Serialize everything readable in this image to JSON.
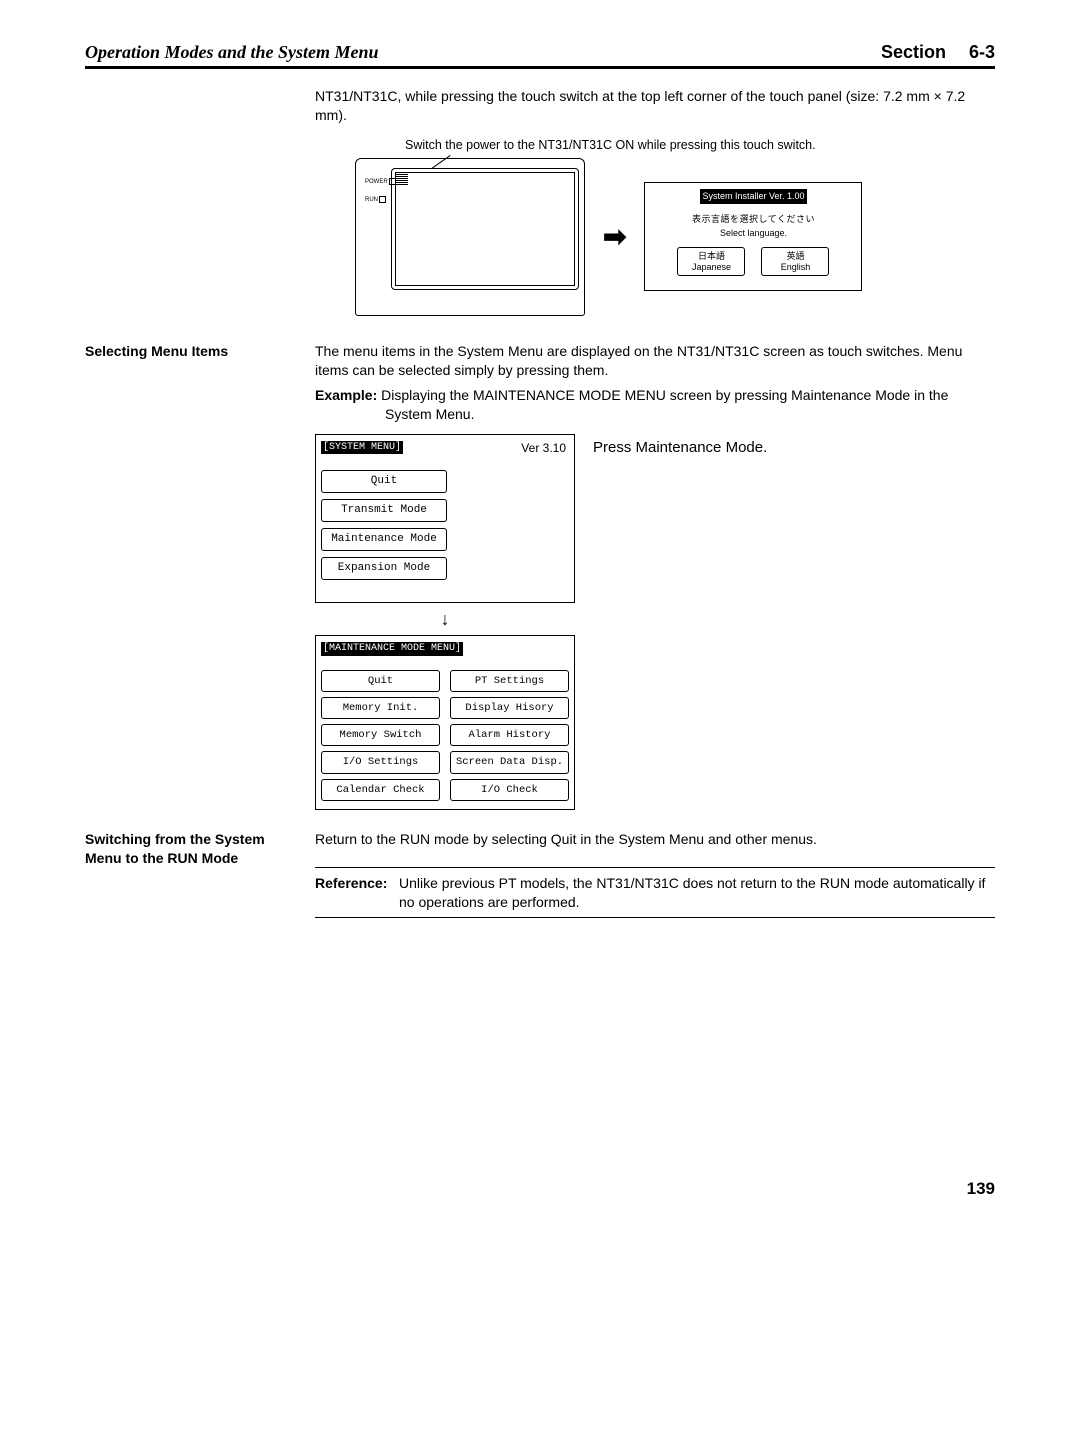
{
  "header": {
    "left": "Operation Modes and the System Menu",
    "section_word": "Section",
    "section_num": "6-3"
  },
  "intro": {
    "para": "NT31/NT31C, while pressing the touch switch at the top left corner of the touch panel (size: 7.2 mm × 7.2 mm).",
    "caption": "Switch the power to the NT31/NT31C ON while pressing this touch switch."
  },
  "touchpanel": {
    "led1": "POWER",
    "led2": "RUN"
  },
  "arrow_right": "➡",
  "lang_panel": {
    "title": "System Installer  Ver. 1.00",
    "line_jp": "表示言語を選択してください",
    "line_en": "Select language.",
    "btn_jp_top": "日本語",
    "btn_jp_bot": "Japanese",
    "btn_en_top": "英語",
    "btn_en_bot": "English"
  },
  "selecting": {
    "side": "Selecting Menu Items",
    "para": "The menu items in the System Menu are displayed on the NT31/NT31C screen as touch switches. Menu items can be selected simply by pressing them.",
    "example_label": "Example:",
    "example_text": "Displaying the MAINTENANCE MODE MENU screen by pressing Maintenance Mode in the System Menu."
  },
  "system_menu_panel": {
    "title": "[SYSTEM MENU]",
    "version": "Ver 3.10",
    "items": [
      "Quit",
      "Transmit Mode",
      "Maintenance Mode",
      "Expansion Mode"
    ]
  },
  "press_note": "Press Maintenance Mode.",
  "arrow_down": "↓",
  "maint_menu_panel": {
    "title": "[MAINTENANCE MODE MENU]",
    "left_col": [
      "Quit",
      "Memory Init.",
      "Memory Switch",
      "I/O Settings",
      "Calendar Check"
    ],
    "right_col": [
      "PT Settings",
      "Display Hisory",
      "Alarm History",
      "Screen Data Disp.",
      "I/O Check"
    ]
  },
  "switching": {
    "side": "Switching from the System Menu to the RUN Mode",
    "para": "Return to the RUN mode by selecting Quit in the System Menu and other menus."
  },
  "reference": {
    "label": "Reference:",
    "text": "Unlike previous PT models, the NT31/NT31C does not return to the RUN mode automatically if no operations are performed."
  },
  "page_number": "139"
}
